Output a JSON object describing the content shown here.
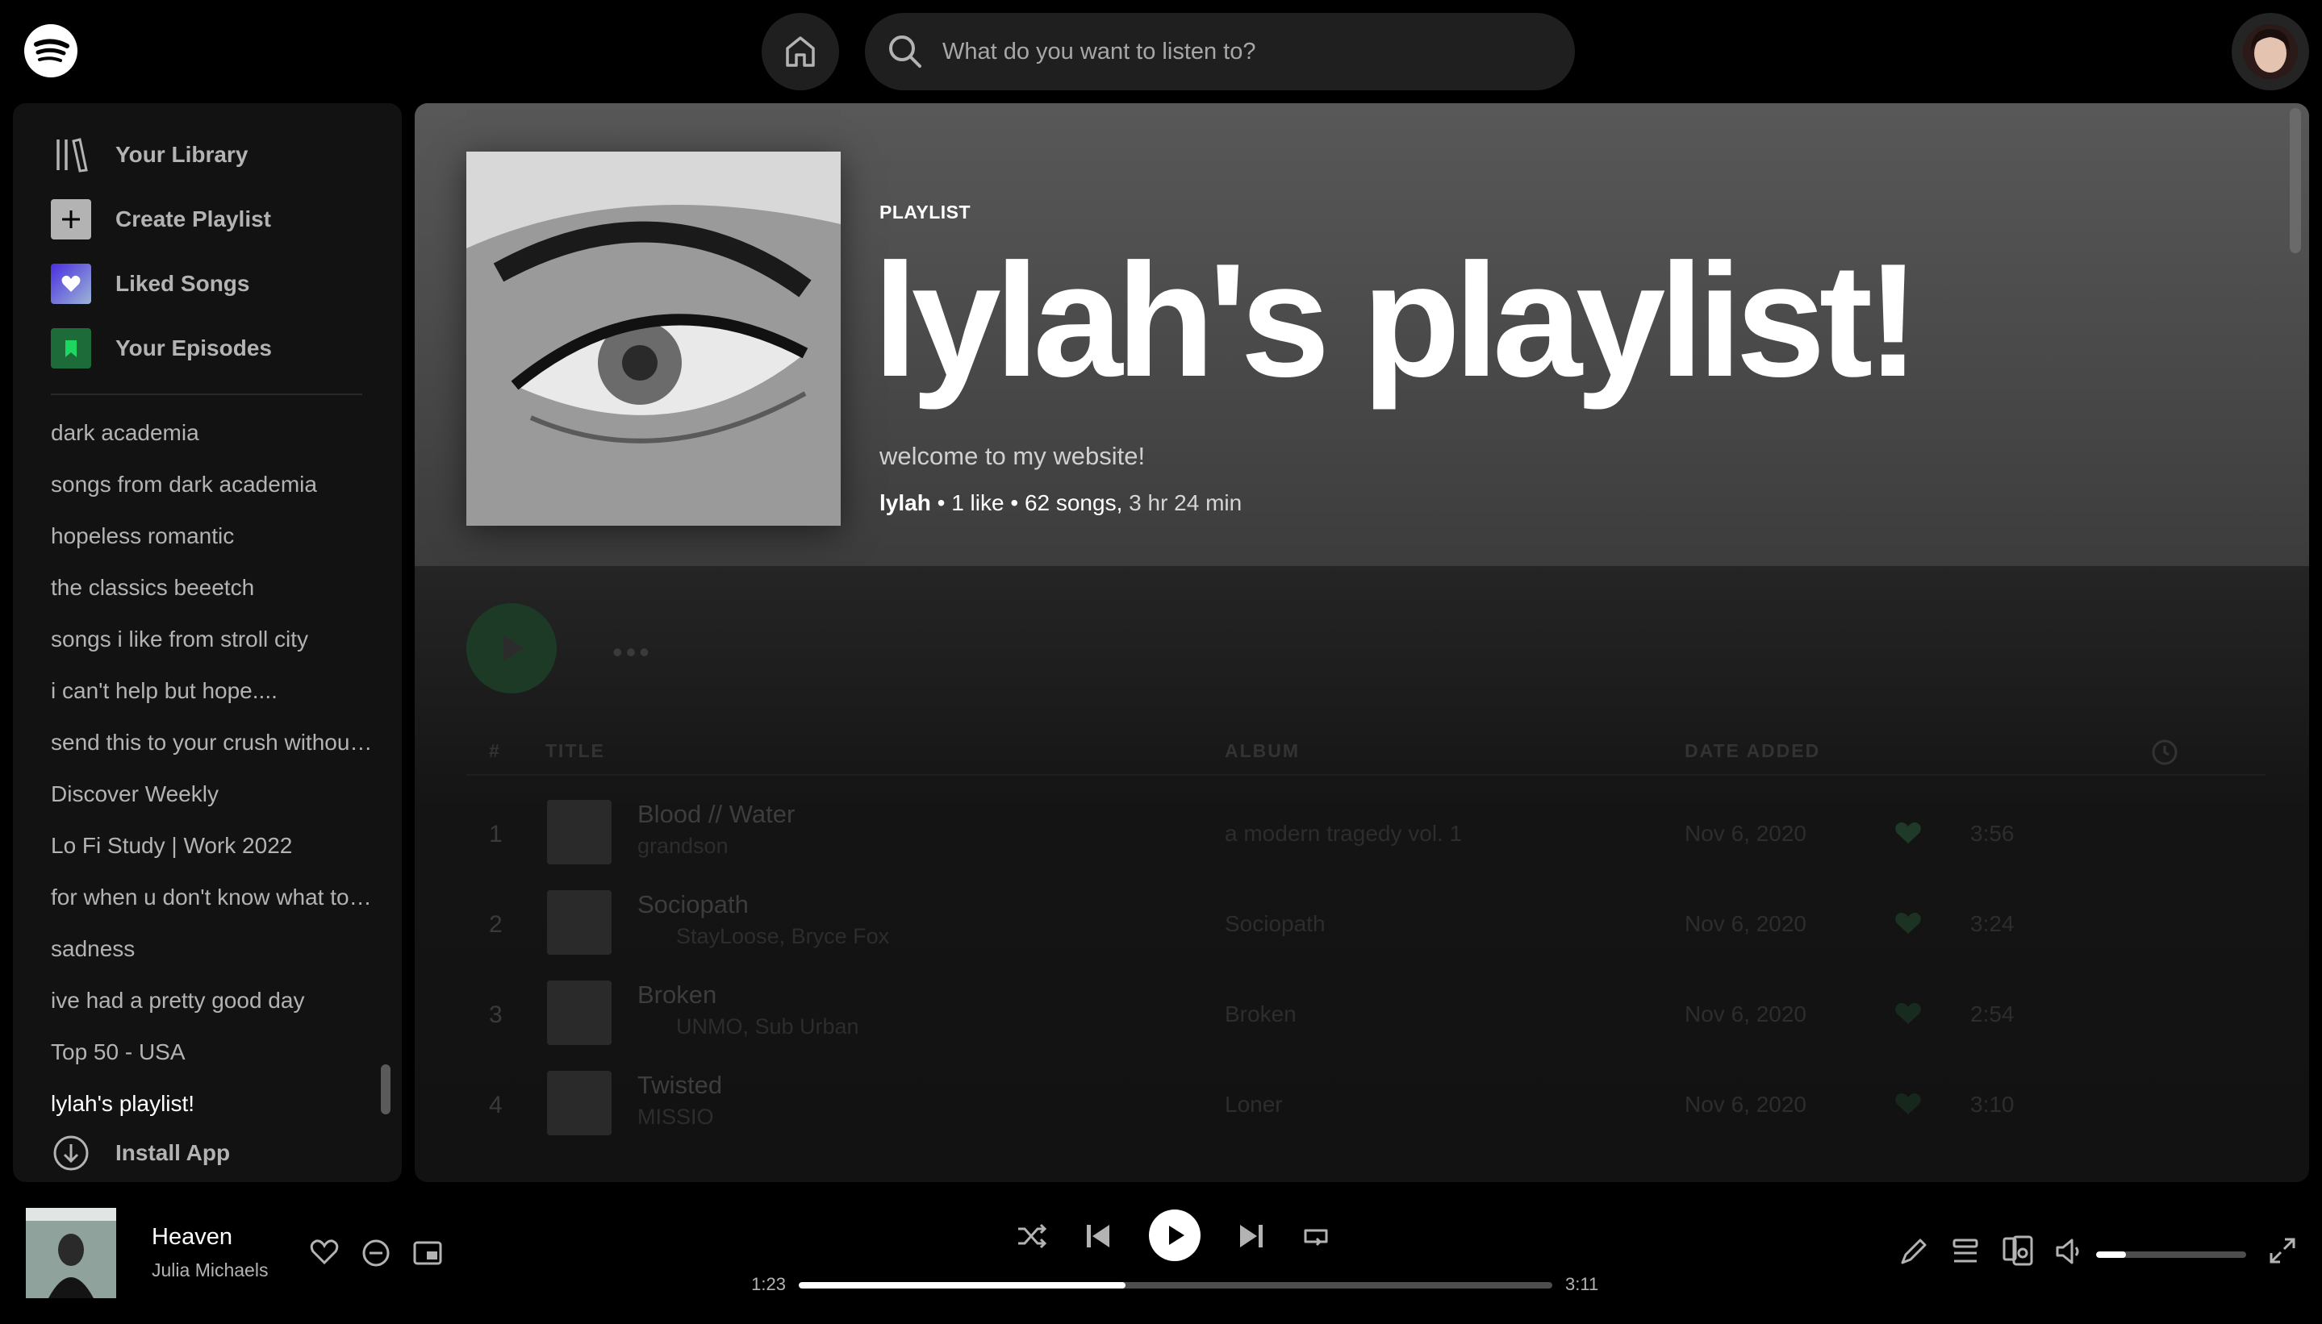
{
  "search": {
    "placeholder": "What do you want to listen to?"
  },
  "sidebar": {
    "nav": [
      {
        "label": "Your Library",
        "icon": "library-icon"
      },
      {
        "label": "Create Playlist",
        "icon": "plus-icon"
      },
      {
        "label": "Liked Songs",
        "icon": "heart-icon",
        "color": "#7b5cf0"
      },
      {
        "label": "Your Episodes",
        "icon": "bookmark-icon",
        "color": "#1e6b3a"
      }
    ],
    "playlists": [
      "dark academia",
      "songs from dark academia",
      "hopeless romantic",
      "the classics beeetch",
      "songs i like from stroll city",
      "i can't help but hope....",
      "send this to your crush without context",
      "Discover Weekly",
      "Lo Fi Study | Work 2022",
      "for when u don't know what to listen to",
      "sadness",
      "ive had a pretty good day",
      "Top 50 - USA",
      "lylah's playlist!"
    ],
    "install": "Install App"
  },
  "playlist": {
    "type": "PLAYLIST",
    "title": "lylah's playlist!",
    "description": "welcome to my website!",
    "owner": "lylah",
    "likes": "1 like",
    "songs": "62 songs,",
    "duration": "3 hr 24 min"
  },
  "table": {
    "headers": {
      "num": "#",
      "title": "TITLE",
      "album": "ALBUM",
      "date": "DATE ADDED"
    },
    "rows": [
      {
        "num": "1",
        "title": "Blood // Water",
        "artist": "grandson",
        "album": "a modern tragedy vol. 1",
        "date": "Nov 6, 2020",
        "duration": "3:56"
      },
      {
        "num": "2",
        "title": "Sociopath",
        "artist": "StayLoose, Bryce Fox",
        "album": "Sociopath",
        "date": "Nov 6, 2020",
        "duration": "3:24"
      },
      {
        "num": "3",
        "title": "Broken",
        "artist": "UNMO, Sub Urban",
        "album": "Broken",
        "date": "Nov 6, 2020",
        "duration": "2:54"
      },
      {
        "num": "4",
        "title": "Twisted",
        "artist": "MISSIO",
        "album": "Loner",
        "date": "Nov 6, 2020",
        "duration": "3:10"
      }
    ]
  },
  "player": {
    "track": "Heaven",
    "artist": "Julia Michaels",
    "current_time": "1:23",
    "total_time": "3:11",
    "progress": 0.434,
    "volume": 0.2
  },
  "colors": {
    "accent": "#1db954",
    "background": "#000000",
    "surface": "#121212"
  }
}
